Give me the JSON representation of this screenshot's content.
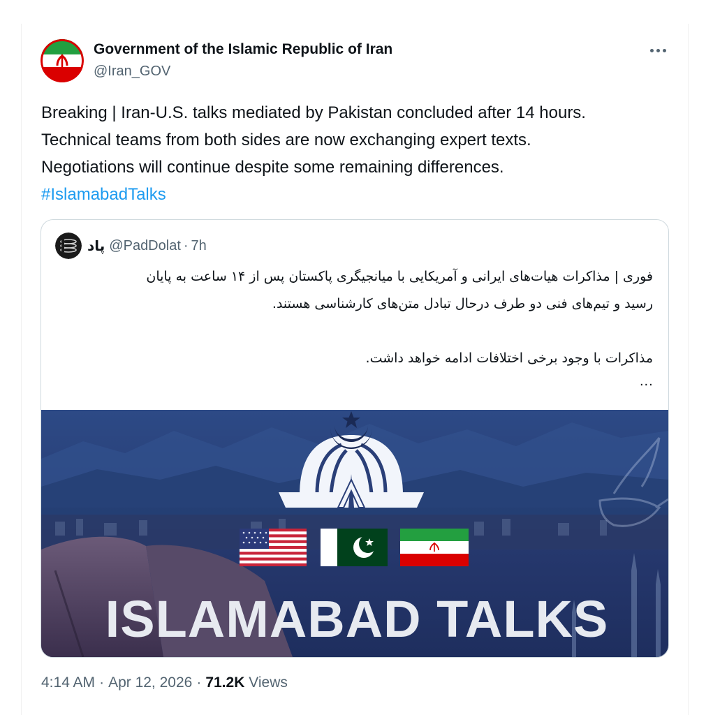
{
  "tweet": {
    "author": {
      "display_name": "Government of the Islamic Republic of Iran",
      "handle": "@Iran_GOV",
      "avatar_icon": "iran-emblem-avatar-icon"
    },
    "more_icon": "more-horizontal-icon",
    "text_lines": [
      "Breaking | Iran-U.S. talks mediated by Pakistan concluded after 14 hours.",
      "Technical teams from both sides are now exchanging expert texts.",
      "Negotiations will continue despite some remaining differences."
    ],
    "hashtag": "#IslamabadTalks",
    "quote": {
      "display_name": "پاد",
      "handle": "@PadDolat",
      "separator": "·",
      "time": "7h",
      "avatar_icon": "pad-logo-avatar-icon",
      "text_lines": [
        "فوری | مذاکرات هیات‌های ایرانی و آمریکایی با میانجیگری پاکستان پس از ۱۴ ساعت به پایان",
        "رسید و تیم‌های فنی دو طرف درحال تبادل متن‌های کارشناسی هستند.",
        "مذاکرات با وجود برخی اختلافات ادامه خواهد داشت."
      ],
      "ellipsis": "...",
      "image": {
        "title": "ISLAMABAD TALKS",
        "flags": [
          "usa-flag-icon",
          "pakistan-flag-icon",
          "iran-flag-icon"
        ],
        "emblem_icon": "pakistan-monument-star-crescent-icon",
        "dove_icon": "dove-icon",
        "colors": {
          "sky_top": "#2d4a86",
          "sky_bottom": "#1e2e5e",
          "iran_green": "#239f40",
          "iran_red": "#da0000",
          "pakistan_green": "#01411c"
        }
      }
    },
    "footer": {
      "time": "4:14 AM",
      "separator": "·",
      "date": "Apr 12, 2026",
      "views_count": "71.2K",
      "views_label": "Views"
    }
  }
}
